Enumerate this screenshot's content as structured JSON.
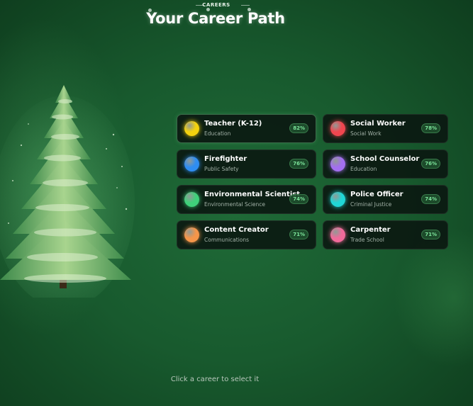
{
  "header": {
    "eyebrow": "CAREERS",
    "title": "Your Career Path"
  },
  "careers": [
    {
      "title": "Teacher (K-12)",
      "category": "Education",
      "match": "82%",
      "color": "#f4d20e",
      "selected": true
    },
    {
      "title": "Social Worker",
      "category": "Social Work",
      "match": "78%",
      "color": "#f0464f"
    },
    {
      "title": "Firefighter",
      "category": "Public Safety",
      "match": "76%",
      "color": "#2f8df2"
    },
    {
      "title": "School Counselor",
      "category": "Education",
      "match": "76%",
      "color": "#a36ff0"
    },
    {
      "title": "Environmental Scientist",
      "category": "Environmental Science",
      "match": "74%",
      "color": "#3fd07a"
    },
    {
      "title": "Police Officer",
      "category": "Criminal Justice",
      "match": "74%",
      "color": "#20d6d6"
    },
    {
      "title": "Content Creator",
      "category": "Communications",
      "match": "71%",
      "color": "#f5964a"
    },
    {
      "title": "Carpenter",
      "category": "Trade School",
      "match": "71%",
      "color": "#f06a9a"
    }
  ],
  "footer": {
    "hint": "Click a career to select it"
  },
  "icons": {
    "decoration": "christmas-tree-icon",
    "career_marker": "orb-icon"
  },
  "colors": {
    "accent": "#7ce39a",
    "background": "#185a2e"
  }
}
